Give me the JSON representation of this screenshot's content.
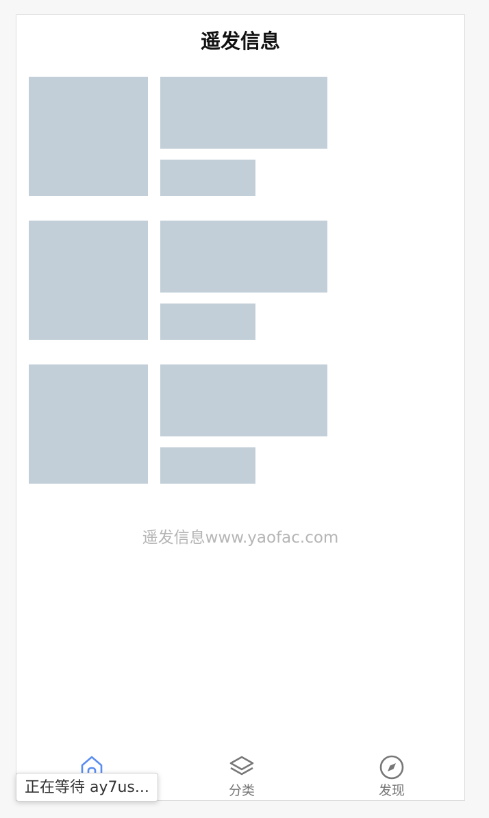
{
  "header": {
    "title": "遥发信息"
  },
  "skeleton_list": {
    "item_count": 3
  },
  "footer": {
    "note": "遥发信息www.yaofac.com"
  },
  "tabbar": {
    "active_color": "#5a8df0",
    "inactive_color": "#777777",
    "items": [
      {
        "label": "",
        "icon": "home-icon",
        "active": true
      },
      {
        "label": "分类",
        "icon": "layers-icon",
        "active": false
      },
      {
        "label": "发现",
        "icon": "compass-icon",
        "active": false
      }
    ]
  },
  "status_bar": {
    "text": "正在等待 ay7us..."
  },
  "colors": {
    "skeleton": "#c3cfd8",
    "background": "#ffffff"
  }
}
